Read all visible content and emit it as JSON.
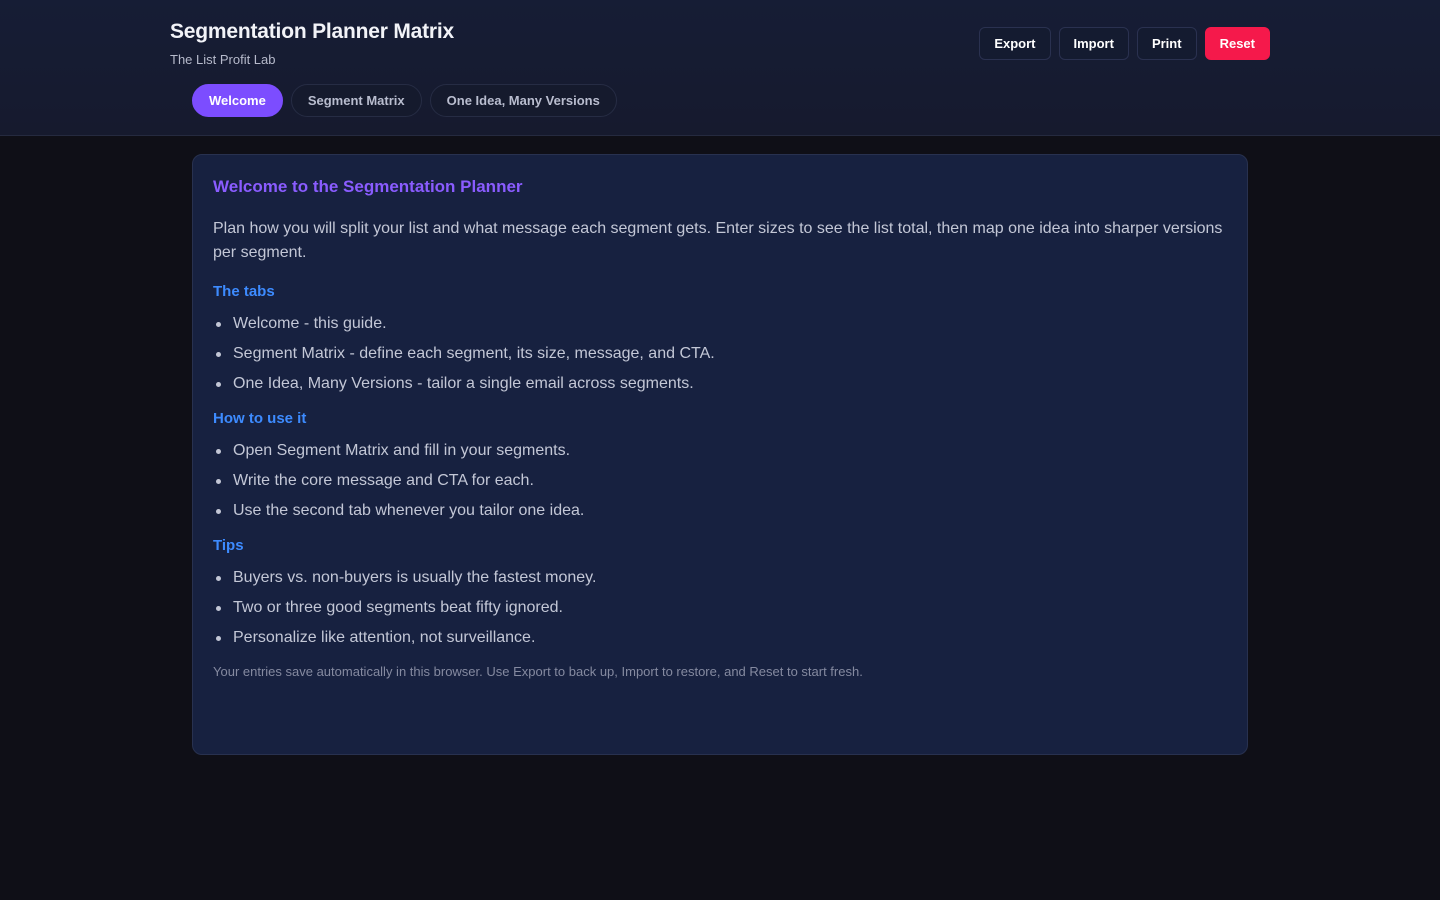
{
  "header": {
    "title": "Segmentation Planner Matrix",
    "subtitle": "The List Profit Lab",
    "actions": {
      "export": "Export",
      "import": "Import",
      "print": "Print",
      "reset": "Reset"
    }
  },
  "tabs": [
    {
      "label": "Welcome",
      "active": true
    },
    {
      "label": "Segment Matrix",
      "active": false
    },
    {
      "label": "One Idea, Many Versions",
      "active": false
    }
  ],
  "welcome": {
    "heading": "Welcome to the Segmentation Planner",
    "intro": "Plan how you will split your list and what message each segment gets. Enter sizes to see the list total, then map one idea into sharper versions per segment.",
    "sections": [
      {
        "title": "The tabs",
        "items": [
          "Welcome - this guide.",
          "Segment Matrix - define each segment, its size, message, and CTA.",
          "One Idea, Many Versions - tailor a single email across segments."
        ]
      },
      {
        "title": "How to use it",
        "items": [
          "Open Segment Matrix and fill in your segments.",
          "Write the core message and CTA for each.",
          "Use the second tab whenever you tailor one idea."
        ]
      },
      {
        "title": "Tips",
        "items": [
          "Buyers vs. non-buyers is usually the fastest money.",
          "Two or three good segments beat fifty ignored.",
          "Personalize like attention, not surveillance."
        ]
      }
    ],
    "footnote": "Your entries save automatically in this browser. Use Export to back up, Import to restore, and Reset to start fresh."
  },
  "colors": {
    "accent": "#7c4dff",
    "heading": "#8a5cff",
    "section": "#3d8bff",
    "danger": "#f5194b",
    "background": "#0f0f17",
    "card": "#172140"
  }
}
